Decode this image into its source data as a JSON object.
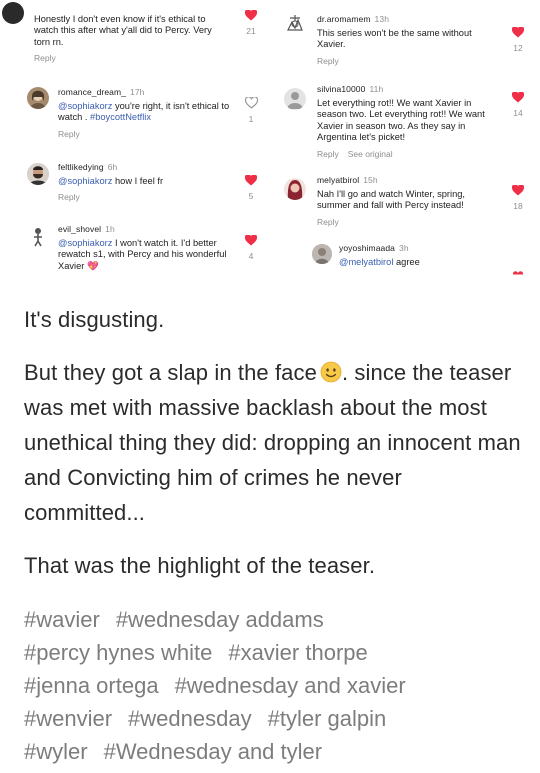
{
  "screenshot": {
    "left_column": [
      {
        "username": "",
        "age": "",
        "text": "Honestly I don't even know if it's ethical to watch this after what y'all did to Percy. Very torn rn.",
        "reply_label": "Reply",
        "like_count": "21",
        "liked": true,
        "avatar_icon": "dark-avatar-icon"
      },
      {
        "username": "romance_dream_",
        "age": "17h",
        "mention": "@sophiakorz",
        "text": " you're right, it isn't ethical to watch . ",
        "hashtag": "#boycottNetflix",
        "reply_label": "Reply",
        "like_count": "1",
        "liked": false,
        "avatar_icon": "woman-avatar-icon"
      },
      {
        "username": "feltlikedying",
        "age": "6h",
        "mention": "@sophiakorz",
        "text": " how I feel fr",
        "reply_label": "Reply",
        "like_count": "5",
        "liked": true,
        "avatar_icon": "bearded-man-avatar-icon"
      },
      {
        "username": "evil_shovel",
        "age": "1h",
        "mention": "@sophiakorz",
        "text": " I won't watch it. I'd better rewatch s1, with Percy and his wonderful Xavier ",
        "emoji": "💖",
        "reply_label": "",
        "like_count": "4",
        "liked": true,
        "avatar_icon": "figure-avatar-icon"
      }
    ],
    "right_column": [
      {
        "username": "dr.aromamem",
        "age": "13h",
        "text": "This series won't be the same without Xavier.",
        "reply_label": "Reply",
        "like_count": "12",
        "liked": true,
        "avatar_icon": "sketch-avatar-icon"
      },
      {
        "username": "silvina10000",
        "age": "11h",
        "text": "Let everything rot!! We want Xavier in season two. Let everything rot!! We want Xavier in season two. As they say in Argentina let's picket!",
        "reply_label": "Reply",
        "see_original": "See original",
        "like_count": "14",
        "liked": true,
        "avatar_icon": "default-user-icon"
      },
      {
        "username": "melyatbirol",
        "age": "15h",
        "text": "Nah I'll go and watch Winter, spring, summer and fall with Percy instead!",
        "reply_label": "Reply",
        "like_count": "18",
        "liked": true,
        "avatar_icon": "red-hair-avatar-icon"
      },
      {
        "username": "yoyoshimaada",
        "age": "3h",
        "mention": "@melyatbirol",
        "text": " agree",
        "reply_label": "",
        "like_count": "",
        "liked": true,
        "avatar_icon": "gray-avatar-icon"
      }
    ]
  },
  "post": {
    "paragraph_1": "It's disgusting.",
    "paragraph_2_before_emoji": "But they got a slap in the face",
    "paragraph_2_after_emoji": ". since the teaser was met with massive backlash about the most unethical thing they did: dropping an innocent man and Convicting him of crimes he never committed...",
    "paragraph_3": "That was the highlight of the teaser.",
    "emoji_icon": "slightly-smiling-face-icon"
  },
  "tags": [
    "#wavier",
    "#wednesday addams",
    "#percy hynes white",
    "#xavier thorpe",
    "#jenna ortega",
    "#wednesday and xavier",
    "#wenvier",
    "#wednesday",
    "#tyler galpin",
    "#wyler",
    "#Wednesday and tyler"
  ],
  "colors": {
    "heart_red": "#ef2f48",
    "mention_blue": "#3a5fb0",
    "muted_gray": "#8e8e8e",
    "tag_gray": "#7d7d7d",
    "emoji_yellow": "#f7c948"
  }
}
